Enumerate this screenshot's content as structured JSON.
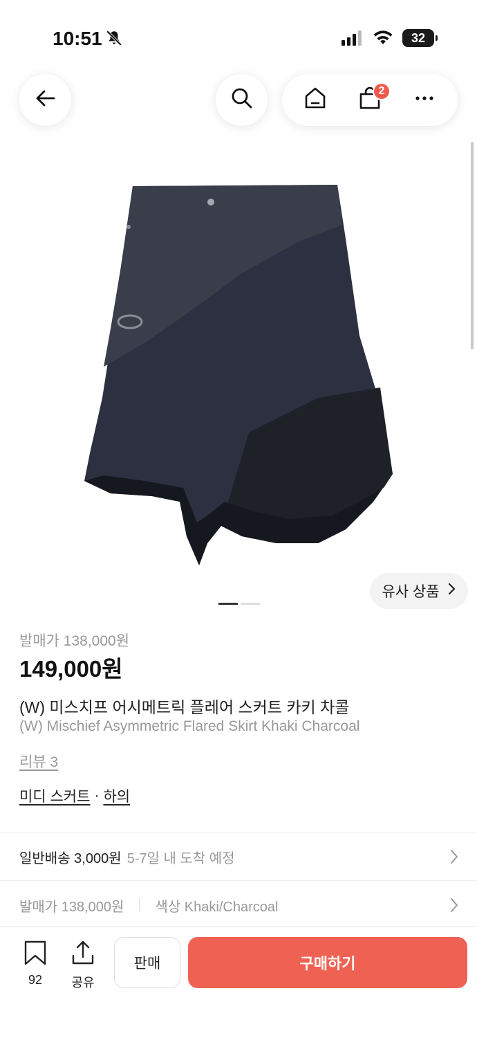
{
  "status_bar": {
    "time": "10:51",
    "battery": "32"
  },
  "header": {
    "cart_count": "2"
  },
  "gallery": {
    "similar_label": "유사 상품",
    "page_count": 2,
    "active_page": 1
  },
  "product": {
    "release_price": "발매가 138,000원",
    "price": "149,000원",
    "name_ko": "(W) 미스치프 어시메트릭 플레어 스커트 카키 차콜",
    "name_en": "(W) Mischief Asymmetric Flared Skirt Khaki Charcoal",
    "review": "리뷰 3",
    "category": [
      "미디 스커트",
      "하의"
    ],
    "category_sep": "·"
  },
  "shipping": {
    "label": "일반배송 3,000원",
    "eta": "5-7일 내 도착 예정"
  },
  "options": {
    "release_price": "발매가 138,000원",
    "color": "색상 Khaki/Charcoal"
  },
  "bottom_bar": {
    "wish_count": "92",
    "share_label": "공유",
    "sell_label": "판매",
    "buy_label": "구매하기"
  },
  "colors": {
    "accent": "#ef6253",
    "badge": "#ef5a4a",
    "skirt": "#2b2f3e"
  }
}
